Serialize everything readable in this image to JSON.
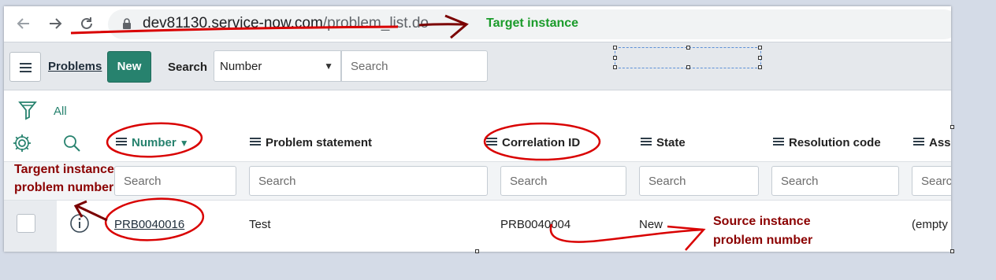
{
  "browser": {
    "back_icon": "arrow-left-icon",
    "forward_icon": "arrow-right-icon",
    "reload_icon": "reload-icon",
    "url_host": "dev81130.service-now.com",
    "url_path": "/problem_list.do"
  },
  "header": {
    "title": "Problems",
    "new_label": "New",
    "search_label": "Search",
    "search_field_value": "Number",
    "search_placeholder": "Search"
  },
  "filter": {
    "breadcrumb": "All"
  },
  "table": {
    "columns": [
      {
        "label": "Number",
        "sorted": "desc"
      },
      {
        "label": "Problem statement"
      },
      {
        "label": "Correlation ID"
      },
      {
        "label": "State"
      },
      {
        "label": "Resolution code"
      },
      {
        "label": "Assi"
      }
    ],
    "column_search_placeholder": [
      "Search",
      "Search",
      "Search",
      "Search",
      "Search",
      "Searc"
    ],
    "rows": [
      {
        "number": "PRB0040016",
        "problem_statement": "Test",
        "correlation_id": "PRB0040004",
        "state": "New",
        "resolution_code": "",
        "assigned": "(empty"
      }
    ]
  },
  "annotations": {
    "target_instance": "Target instance",
    "target_problem_line1": "Targent instance",
    "target_problem_line2": "problem number",
    "source_problem_line1": "Source instance",
    "source_problem_line2": "problem number"
  },
  "colors": {
    "accent": "#27826e",
    "annotation_red": "#d90000",
    "annotation_dark_red": "#8b0000",
    "annotation_green": "#1a9b2a"
  }
}
